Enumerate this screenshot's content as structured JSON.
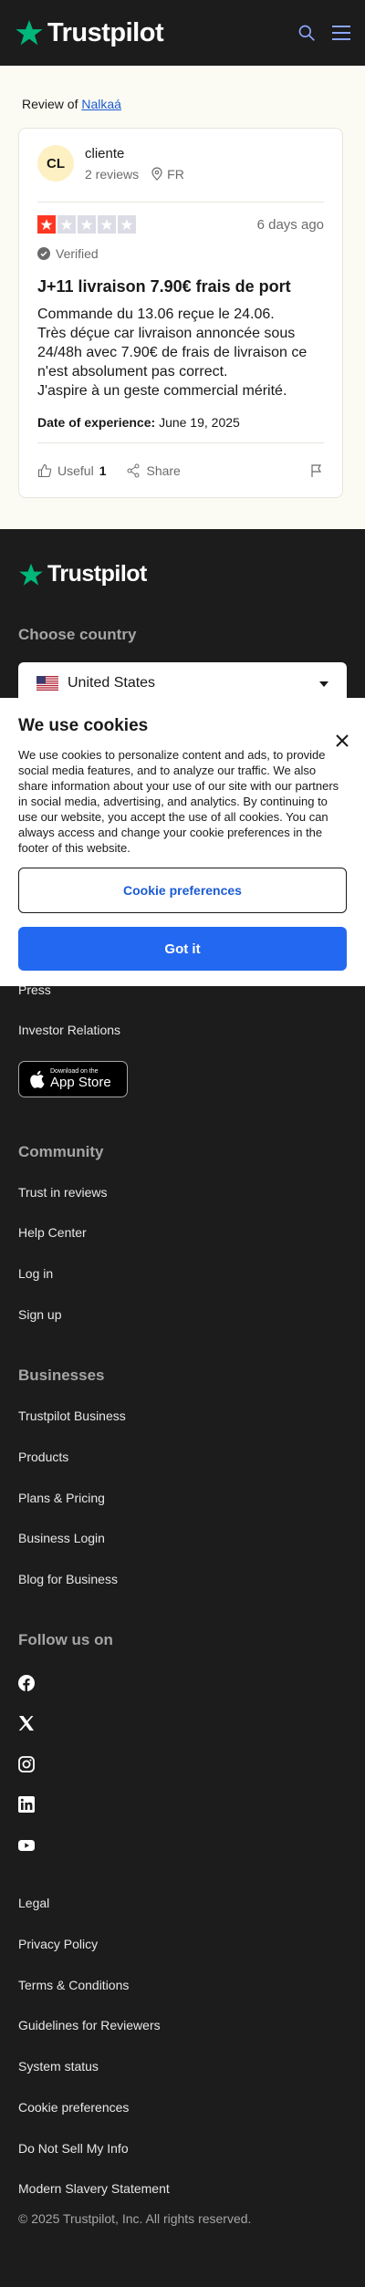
{
  "header": {
    "brand": "Trustpilot",
    "icons": [
      "search-icon",
      "menu-icon"
    ]
  },
  "review": {
    "review_of_prefix": "Review of",
    "business": "Nalkaá",
    "user": {
      "initials": "CL",
      "name": "cliente",
      "reviews": "2 reviews",
      "country": "FR"
    },
    "rating": 1,
    "date": "6 days ago",
    "verified": "Verified",
    "title": "J+11 livraison 7.90€ frais de port",
    "body_lines": [
      "Commande du 13.06 reçue le 24.06.",
      "Très déçue car livraison annoncée sous 24/48h avec 7.90€ de frais de livraison ce n'est absolument pas correct.",
      "J'aspire à un geste commercial mérité."
    ],
    "experience_label": "Date of experience:",
    "experience_date": "June 19, 2025",
    "useful_label": "Useful",
    "useful_count": "1",
    "share_label": "Share"
  },
  "footer": {
    "brand": "Trustpilot",
    "choose_country": "Choose country",
    "country": "United States",
    "links_top": [
      "Press",
      "Investor Relations"
    ],
    "appstore": {
      "line1": "Download on the",
      "line2": "App Store"
    },
    "community": {
      "heading": "Community",
      "links": [
        "Trust in reviews",
        "Help Center",
        "Log in",
        "Sign up"
      ]
    },
    "businesses": {
      "heading": "Businesses",
      "links": [
        "Trustpilot Business",
        "Products",
        "Plans & Pricing",
        "Business Login",
        "Blog for Business"
      ]
    },
    "follow": {
      "heading": "Follow us on",
      "icons": [
        "facebook-icon",
        "x-icon",
        "instagram-icon",
        "linkedin-icon",
        "youtube-icon"
      ]
    },
    "legal_links": [
      "Legal",
      "Privacy Policy",
      "Terms & Conditions",
      "Guidelines for Reviewers",
      "System status",
      "Cookie preferences",
      "Do Not Sell My Info",
      "Modern Slavery Statement"
    ],
    "copyright": "© 2025 Trustpilot, Inc. All rights reserved."
  },
  "cookie": {
    "title": "We use cookies",
    "text": "We use cookies to personalize content and ads, to provide social media features, and to analyze our traffic. We also share information about your use of our site with our partners in social media, advertising, and analytics. By continuing to use our website, you accept the use of all cookies. You can always access and change your cookie preferences in the footer of this website.",
    "preferences_button": "Cookie preferences",
    "accept_button": "Got it"
  },
  "colors": {
    "brand_green": "#00b67a",
    "star_red": "#ff3722",
    "link_blue": "#1b5bd3",
    "button_blue": "#2368f1"
  }
}
